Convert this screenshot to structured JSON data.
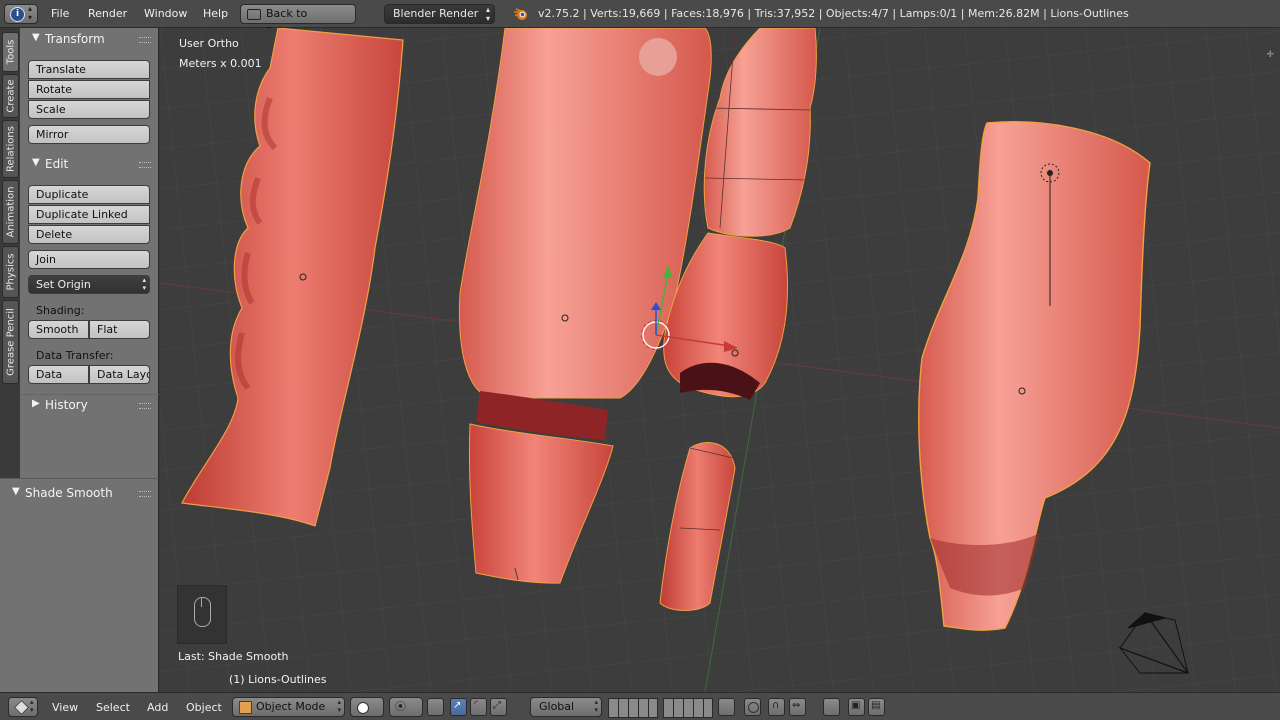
{
  "topbar": {
    "info_icon": "info-icon",
    "menus": [
      "File",
      "Render",
      "Window",
      "Help"
    ],
    "back_button": "Back to Previous",
    "render_engine": "Blender Render",
    "status": "v2.75.2 | Verts:19,669 | Faces:18,976 | Tris:37,952 | Objects:4/7 | Lamps:0/1 | Mem:26.82M | Lions-Outlines"
  },
  "tabs": [
    "Tools",
    "Create",
    "Relations",
    "Animation",
    "Physics",
    "Grease Pencil"
  ],
  "toolshelf": {
    "transform": {
      "title": "Transform",
      "buttons": [
        "Translate",
        "Rotate",
        "Scale",
        "Mirror"
      ]
    },
    "edit": {
      "title": "Edit",
      "buttons": [
        "Duplicate",
        "Duplicate Linked",
        "Delete",
        "Join"
      ],
      "set_origin": "Set Origin",
      "shading_label": "Shading:",
      "smooth": "Smooth",
      "flat": "Flat",
      "data_transfer_label": "Data Transfer:",
      "data": "Data",
      "data_layout": "Data Layo"
    },
    "history": {
      "title": "History"
    }
  },
  "last_operator": {
    "title": "Shade Smooth"
  },
  "viewport": {
    "view_name": "User Ortho",
    "units": "Meters x 0.001",
    "last_op": "Last: Shade Smooth",
    "active_object": "(1) Lions-Outlines"
  },
  "bottombar": {
    "menus": [
      "View",
      "Select",
      "Add",
      "Object"
    ],
    "mode": "Object Mode",
    "orientation": "Global"
  },
  "colors": {
    "mesh": "#d8544a",
    "selection_outline": "#f2a040",
    "x_axis": "#c83a3a",
    "y_axis": "#4caf3f",
    "z_axis": "#2a4fd8"
  }
}
